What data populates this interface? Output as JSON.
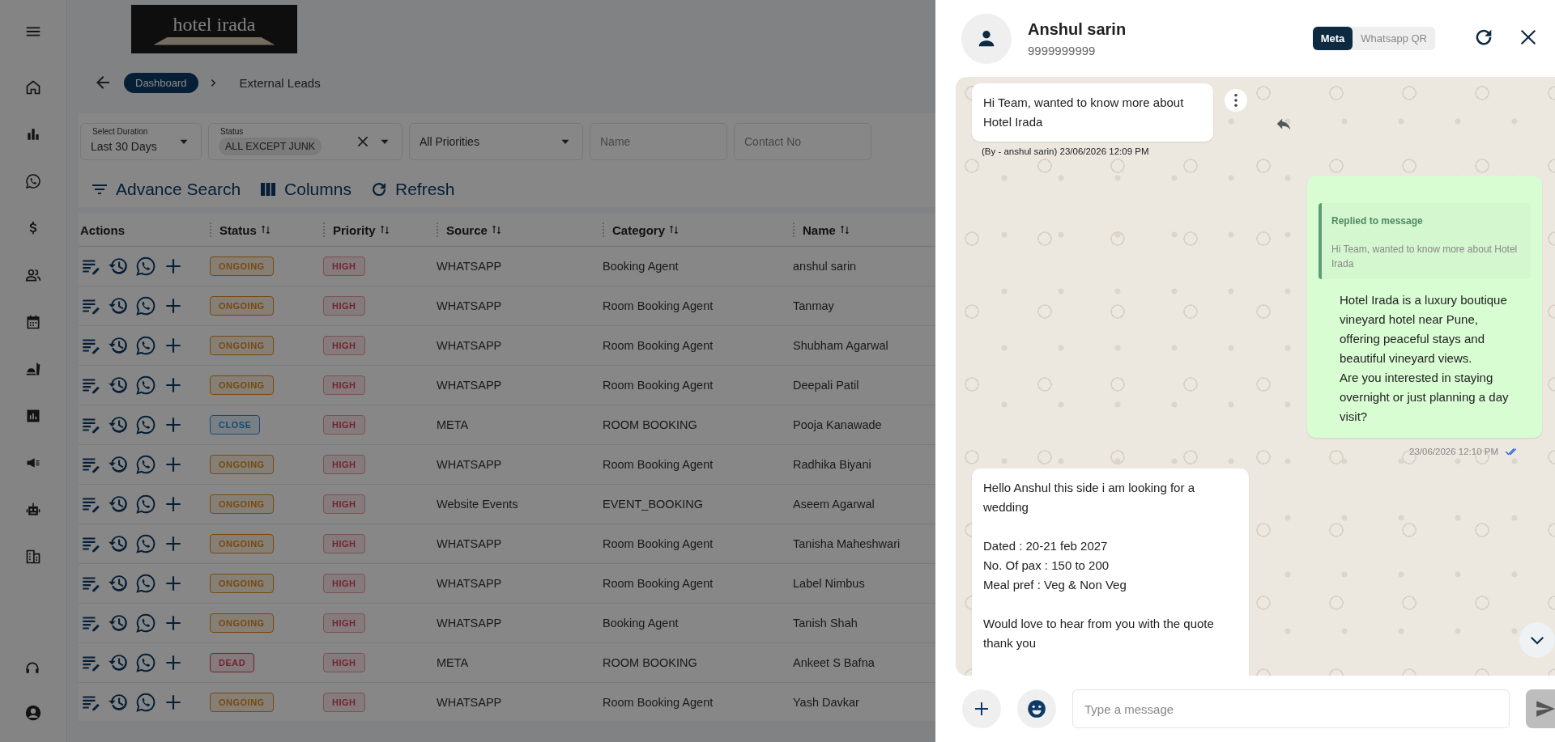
{
  "logo": {
    "text": "hotel irada"
  },
  "breadcrumb": [
    {
      "label": "Dashboard",
      "selected": true
    },
    {
      "label": "External Leads",
      "selected": false
    }
  ],
  "filters": [
    {
      "kind": "select",
      "label": "Select Duration",
      "value": "Last 30 Days"
    },
    {
      "kind": "chips",
      "label": "Status",
      "value": "ALL EXCEPT JUNK"
    },
    {
      "kind": "select",
      "value": "All Priorities"
    },
    {
      "kind": "text",
      "placeholder": "Name"
    },
    {
      "kind": "text",
      "placeholder": "Contact No"
    }
  ],
  "toolbar": [
    {
      "kind": "filter",
      "label": "Advance Search"
    },
    {
      "kind": "columns",
      "label": "Columns"
    },
    {
      "kind": "refresh",
      "label": "Refresh"
    }
  ],
  "table": {
    "columns": [
      "Actions",
      "Status",
      "Priority",
      "Source",
      "Category",
      "Name"
    ],
    "rows": [
      {
        "status": {
          "label": "ONGOING",
          "kind": "ongoing"
        },
        "priority": "HIGH",
        "source": "WHATSAPP",
        "category": "Booking Agent",
        "name": "anshul sarin"
      },
      {
        "status": {
          "label": "ONGOING",
          "kind": "ongoing"
        },
        "priority": "HIGH",
        "source": "WHATSAPP",
        "category": "Room Booking Agent",
        "name": "Tanmay"
      },
      {
        "status": {
          "label": "ONGOING",
          "kind": "ongoing"
        },
        "priority": "HIGH",
        "source": "WHATSAPP",
        "category": "Room Booking Agent",
        "name": "Shubham Agarwal"
      },
      {
        "status": {
          "label": "ONGOING",
          "kind": "ongoing"
        },
        "priority": "HIGH",
        "source": "WHATSAPP",
        "category": "Room Booking Agent",
        "name": "Deepali Patil"
      },
      {
        "status": {
          "label": "CLOSE",
          "kind": "close"
        },
        "priority": "HIGH",
        "source": "META",
        "category": "ROOM BOOKING",
        "name": "Pooja Kanawade"
      },
      {
        "status": {
          "label": "ONGOING",
          "kind": "ongoing"
        },
        "priority": "HIGH",
        "source": "WHATSAPP",
        "category": "Room Booking Agent",
        "name": "Radhika Biyani"
      },
      {
        "status": {
          "label": "ONGOING",
          "kind": "ongoing"
        },
        "priority": "HIGH",
        "source": "Website Events",
        "category": "EVENT_BOOKING",
        "name": "Aseem Agarwal"
      },
      {
        "status": {
          "label": "ONGOING",
          "kind": "ongoing"
        },
        "priority": "HIGH",
        "source": "WHATSAPP",
        "category": "Room Booking Agent",
        "name": "Tanisha Maheshwari"
      },
      {
        "status": {
          "label": "ONGOING",
          "kind": "ongoing"
        },
        "priority": "HIGH",
        "source": "WHATSAPP",
        "category": "Room Booking Agent",
        "name": "Label Nimbus"
      },
      {
        "status": {
          "label": "ONGOING",
          "kind": "ongoing"
        },
        "priority": "HIGH",
        "source": "WHATSAPP",
        "category": "Booking Agent",
        "name": "Tanish Shah"
      },
      {
        "status": {
          "label": "DEAD",
          "kind": "dead"
        },
        "priority": "HIGH",
        "source": "META",
        "category": "ROOM BOOKING",
        "name": "Ankeet S Bafna"
      },
      {
        "status": {
          "label": "ONGOING",
          "kind": "ongoing"
        },
        "priority": "HIGH",
        "source": "WHATSAPP",
        "category": "Room Booking Agent",
        "name": "Yash Davkar"
      }
    ]
  },
  "chat": {
    "contact": {
      "name": "Anshul sarin",
      "phone": "9999999999"
    },
    "channels": [
      {
        "label": "Meta",
        "selected": true
      },
      {
        "label": "Whatsapp QR",
        "selected": false
      }
    ],
    "messages": [
      {
        "kind": "incoming",
        "text": "Hi Team, wanted to know more about Hotel Irada",
        "meta": "(By - anshul sarin) 23/06/2026 12:09 PM"
      },
      {
        "kind": "outgoing",
        "reply": {
          "title": "Replied to message",
          "text": "Hi Team, wanted to know more about Hotel Irada"
        },
        "text": "Hotel Irada is a luxury boutique vineyard hotel near Pune, offering peaceful stays and beautiful vineyard views.\nAre you interested in staying overnight or just planning a day visit?",
        "meta": "23/06/2026 12:10 PM",
        "read": true
      },
      {
        "kind": "incoming",
        "text": "Hello Anshul this side i am looking for a wedding\n\nDated : 20-21 feb 2027\nNo. Of pax : 150 to 200\nMeal pref : Veg & Non Veg\n\nWould love to hear from you with the quote\nthank you"
      }
    ],
    "composer": {
      "placeholder": "Type a message"
    }
  }
}
